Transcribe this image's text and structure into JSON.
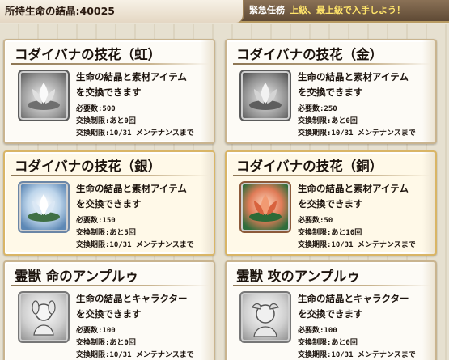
{
  "header": {
    "crystal_label": "所持生命の結晶:40025",
    "notice_label": "緊急任務",
    "notice_message": "上級、最上級で入手しよう！"
  },
  "cards": [
    {
      "title": "コダイバナの技花（虹）",
      "desc1": "生命の結晶と素材アイテム",
      "desc2": "を交換できます",
      "required": "必要数:500",
      "limit": "交換制限:あと0回",
      "deadline": "交換期限:10/31 メンテナンスまで",
      "icon": "lotus-rainbow-icon"
    },
    {
      "title": "コダイバナの技花（金）",
      "desc1": "生命の結晶と素材アイテム",
      "desc2": "を交換できます",
      "required": "必要数:250",
      "limit": "交換制限:あと0回",
      "deadline": "交換期限:10/31 メンテナンスまで",
      "icon": "lotus-gold-icon"
    },
    {
      "title": "コダイバナの技花（銀）",
      "desc1": "生命の結晶と素材アイテム",
      "desc2": "を交換できます",
      "required": "必要数:150",
      "limit": "交換制限:あと5回",
      "deadline": "交換期限:10/31 メンテナンスまで",
      "icon": "lotus-silver-icon"
    },
    {
      "title": "コダイバナの技花（銅）",
      "desc1": "生命の結晶と素材アイテム",
      "desc2": "を交換できます",
      "required": "必要数:50",
      "limit": "交換制限:あと10回",
      "deadline": "交換期限:10/31 メンテナンスまで",
      "icon": "lotus-bronze-icon"
    },
    {
      "title": "霊獣 命のアンプルゥ",
      "desc1": "生命の結晶とキャラクター",
      "desc2": "を交換できます",
      "required": "必要数:100",
      "limit": "交換制限:あと0回",
      "deadline": "交換期限:10/31 メンテナンスまで",
      "icon": "spirit-beast-life-icon"
    },
    {
      "title": "霊獣 攻のアンプルゥ",
      "desc1": "生命の結晶とキャラクター",
      "desc2": "を交換できます",
      "required": "必要数:100",
      "limit": "交換制限:あと0回",
      "deadline": "交換期限:10/31 メンテナンスまで",
      "icon": "spirit-beast-attack-icon"
    }
  ]
}
